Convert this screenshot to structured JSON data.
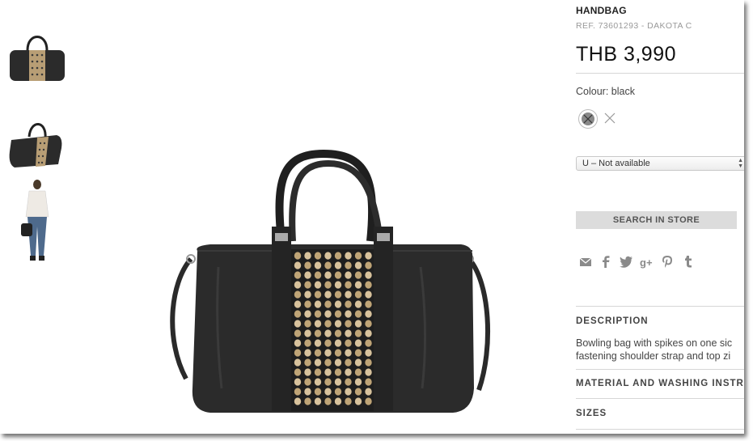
{
  "gallery": {
    "thumbnails": [
      "bag-front-thumbnail",
      "bag-angle-thumbnail",
      "model-thumbnail"
    ],
    "main_image": "studded-handbag-main-image"
  },
  "product": {
    "title": "HANDBAG",
    "ref": "REF. 73601293 - DAKOTA C",
    "price": "THB 3,990",
    "colour_label": "Colour: black",
    "size_select": {
      "selected": "U – Not available"
    },
    "search_store_label": "SEARCH IN STORE",
    "share_icons": [
      "email-icon",
      "facebook-icon",
      "twitter-icon",
      "google-plus-icon",
      "pinterest-icon",
      "tumblr-icon"
    ],
    "sections": {
      "description_heading": "DESCRIPTION",
      "description_line1": "Bowling bag with spikes on one sic",
      "description_line2": "fastening shoulder strap and top zi",
      "material_heading": "MATERIAL AND WASHING INSTR",
      "sizes_heading": "SIZES"
    }
  },
  "colors": {
    "leather": "#2b2b2b",
    "studs": "#c8ad80",
    "button_bg": "#dcdcdc",
    "icon_grey": "#8a8a8a"
  }
}
